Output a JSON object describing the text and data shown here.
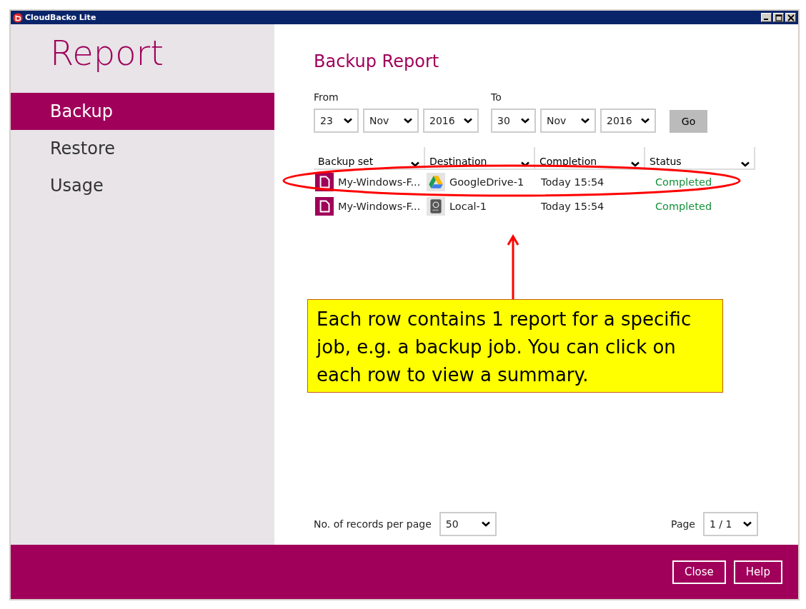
{
  "window": {
    "title": "CloudBacko Lite"
  },
  "sidebar": {
    "title": "Report",
    "items": [
      {
        "label": "Backup",
        "selected": true
      },
      {
        "label": "Restore",
        "selected": false
      },
      {
        "label": "Usage",
        "selected": false
      }
    ]
  },
  "main": {
    "title": "Backup Report",
    "from": {
      "label": "From",
      "day": "23",
      "month": "Nov",
      "year": "2016"
    },
    "to": {
      "label": "To",
      "day": "30",
      "month": "Nov",
      "year": "2016"
    },
    "go_button": "Go"
  },
  "table": {
    "columns": [
      "Backup set",
      "Destination",
      "Completion",
      "Status"
    ],
    "rows": [
      {
        "backup_set": "My-Windows-F...",
        "destination": "GoogleDrive-1",
        "kind": "cloud",
        "completion": "Today 15:54",
        "status": "Completed"
      },
      {
        "backup_set": "My-Windows-F...",
        "destination": "Local-1",
        "kind": "local",
        "completion": "Today 15:54",
        "status": "Completed"
      }
    ]
  },
  "pagination": {
    "records_label": "No. of records per page",
    "records_value": "50",
    "page_label": "Page",
    "page_value": "1 / 1"
  },
  "footer": {
    "buttons": [
      "Close",
      "Help"
    ]
  },
  "annotation": {
    "callout": "Each row contains 1 report for a specific job, e.g. a backup job. You can click on each row to view a summary."
  }
}
